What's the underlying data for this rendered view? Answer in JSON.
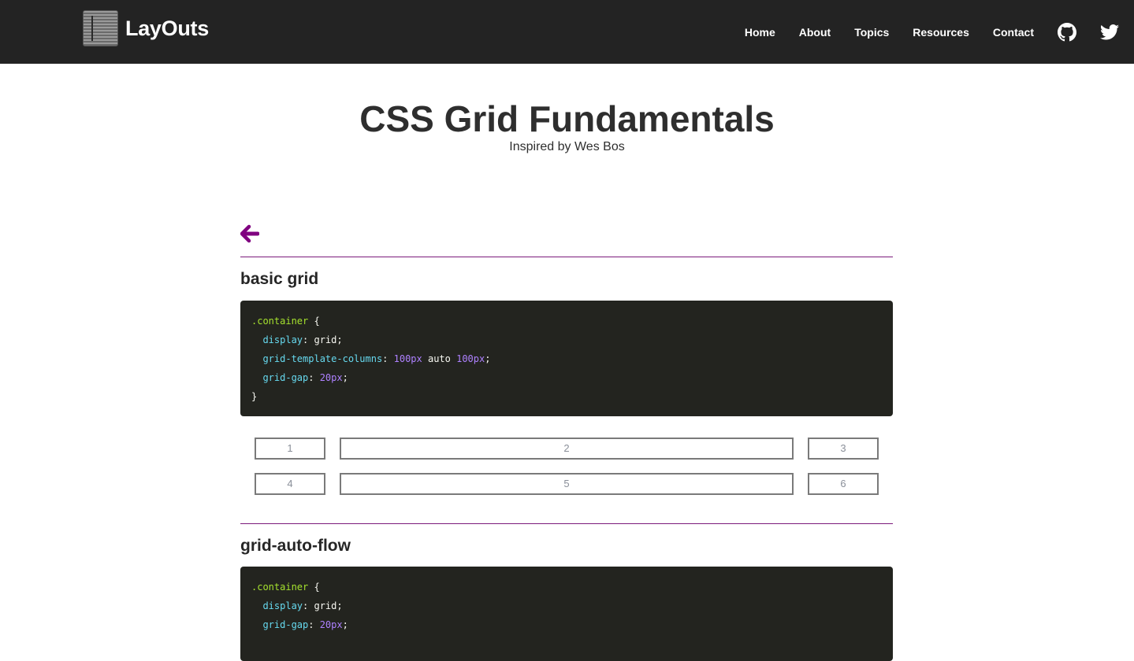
{
  "header": {
    "brand": "LayOuts",
    "nav": [
      "Home",
      "About",
      "Topics",
      "Resources",
      "Contact"
    ],
    "icons": [
      "github-icon",
      "twitter-icon"
    ]
  },
  "hero": {
    "title": "CSS Grid Fundamentals",
    "subtitle": "Inspired by Wes Bos"
  },
  "colors": {
    "accent": "#7b1a7b",
    "code_bg": "#23241f",
    "header_bg": "#232323"
  },
  "sections": [
    {
      "title": "basic grid",
      "code": [
        [
          {
            "t": ".container",
            "c": "sel"
          },
          {
            "t": " {",
            "c": "plain"
          }
        ],
        [
          {
            "t": "  display",
            "c": "prop"
          },
          {
            "t": ": grid;",
            "c": "plain"
          }
        ],
        [
          {
            "t": "  grid-template-columns",
            "c": "prop"
          },
          {
            "t": ": ",
            "c": "plain"
          },
          {
            "t": "100px",
            "c": "num"
          },
          {
            "t": " auto ",
            "c": "plain"
          },
          {
            "t": "100px",
            "c": "num"
          },
          {
            "t": ";",
            "c": "plain"
          }
        ],
        [
          {
            "t": "  grid-gap",
            "c": "prop"
          },
          {
            "t": ": ",
            "c": "plain"
          },
          {
            "t": "20px",
            "c": "num"
          },
          {
            "t": ";",
            "c": "plain"
          }
        ],
        [
          {
            "t": "}",
            "c": "plain"
          }
        ]
      ],
      "cells": [
        "1",
        "2",
        "3",
        "4",
        "5",
        "6"
      ]
    },
    {
      "title": "grid-auto-flow",
      "code": [
        [
          {
            "t": ".container",
            "c": "sel"
          },
          {
            "t": " {",
            "c": "plain"
          }
        ],
        [
          {
            "t": "  display",
            "c": "prop"
          },
          {
            "t": ": grid;",
            "c": "plain"
          }
        ],
        [
          {
            "t": "  grid-gap",
            "c": "prop"
          },
          {
            "t": ": ",
            "c": "plain"
          },
          {
            "t": "20px",
            "c": "num"
          },
          {
            "t": ";",
            "c": "plain"
          }
        ]
      ]
    }
  ]
}
